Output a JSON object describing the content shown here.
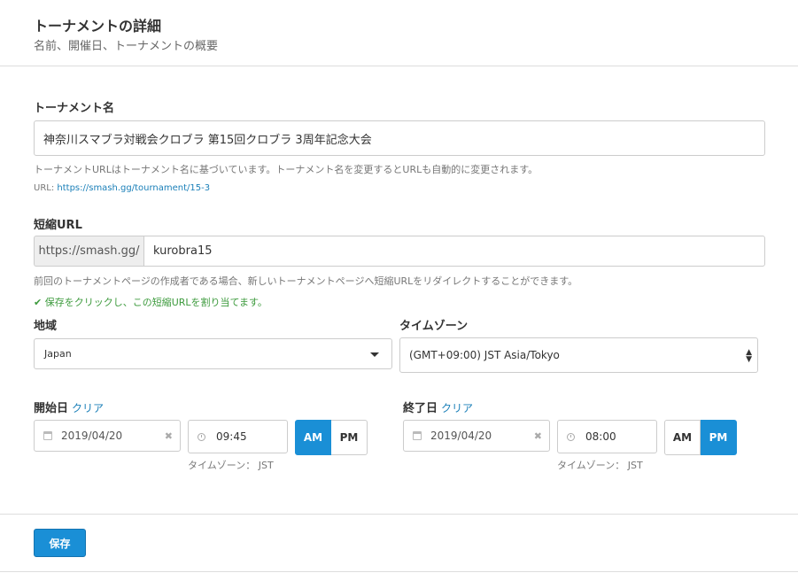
{
  "header": {
    "title": "トーナメントの詳細",
    "subtitle": "名前、開催日、トーナメントの概要"
  },
  "tournament_name": {
    "label": "トーナメント名",
    "value": "神奈川スマブラ対戦会クロブラ 第15回クロブラ 3周年記念大会",
    "help": "トーナメントURLはトーナメント名に基づいています。トーナメント名を変更するとURLも自動的に変更されます。",
    "url_prefix": "URL: ",
    "url_value": "https://smash.gg/tournament/15-3"
  },
  "short_url": {
    "label": "短縮URL",
    "prefix": "https://smash.gg/",
    "value": "kurobra15",
    "help": "前回のトーナメントページの作成者である場合、新しいトーナメントページへ短縮URLをリダイレクトすることができます。",
    "success": "保存をクリックし、この短縮URLを割り当てます。"
  },
  "region": {
    "label": "地域",
    "selected": "Japan"
  },
  "timezone": {
    "label": "タイムゾーン",
    "selected": "(GMT+09:00) JST Asia/Tokyo"
  },
  "start": {
    "label": "開始日",
    "clear": "クリア",
    "date": "2019/04/20",
    "time": "09:45",
    "tz_note": "タイムゾーン： JST",
    "am": "AM",
    "pm": "PM",
    "active": "AM"
  },
  "end": {
    "label": "終了日",
    "clear": "クリア",
    "date": "2019/04/20",
    "time": "08:00",
    "tz_note": "タイムゾーン： JST",
    "am": "AM",
    "pm": "PM",
    "active": "PM"
  },
  "footer": {
    "save_label": "保存"
  },
  "colors": {
    "primary": "#1a8fd6",
    "link": "#1a7fb8",
    "success": "#3c9a3c"
  }
}
